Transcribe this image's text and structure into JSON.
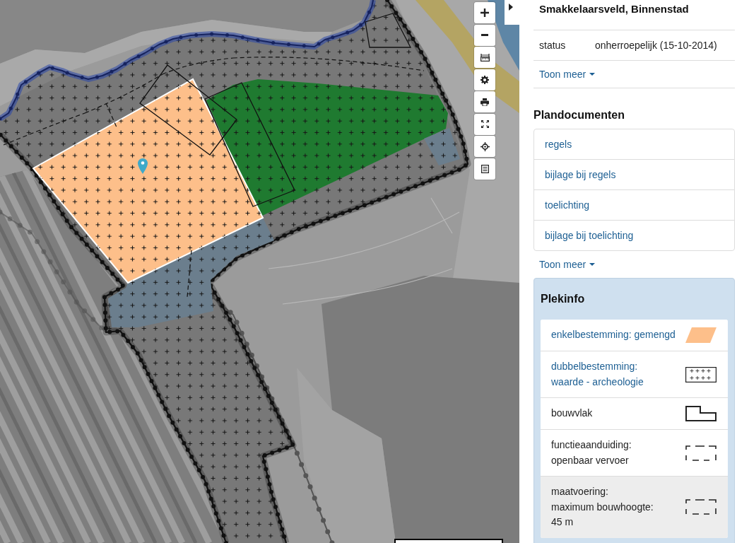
{
  "sidebar": {
    "title": "Smakkelaarsveld, Binnenstad",
    "properties": [
      {
        "label": "status",
        "value": "onherroepelijk (15-10-2014)"
      }
    ],
    "properties_more": "Toon meer",
    "documents": {
      "heading": "Plandocumenten",
      "items": [
        "regels",
        "bijlage bij regels",
        "toelichting",
        "bijlage bij toelichting"
      ],
      "more": "Toon meer"
    },
    "plekinfo": {
      "heading": "Plekinfo",
      "items": [
        {
          "kind": "area",
          "lines": [
            "enkelbestemming: gemengd"
          ],
          "link": true,
          "selected": false,
          "color": "#fdbf8a"
        },
        {
          "kind": "hatch",
          "lines": [
            "dubbelbestemming:",
            "waarde - archeologie"
          ],
          "link": true,
          "selected": false
        },
        {
          "kind": "outline",
          "lines": [
            "bouwvlak"
          ],
          "link": false,
          "selected": false
        },
        {
          "kind": "dashed",
          "lines": [
            "functieaanduiding:",
            "openbaar vervoer"
          ],
          "link": false,
          "selected": false
        },
        {
          "kind": "dashed",
          "lines": [
            "maatvoering:",
            "maximum bouwhoogte:",
            "45 m"
          ],
          "link": false,
          "selected": true
        }
      ]
    }
  }
}
